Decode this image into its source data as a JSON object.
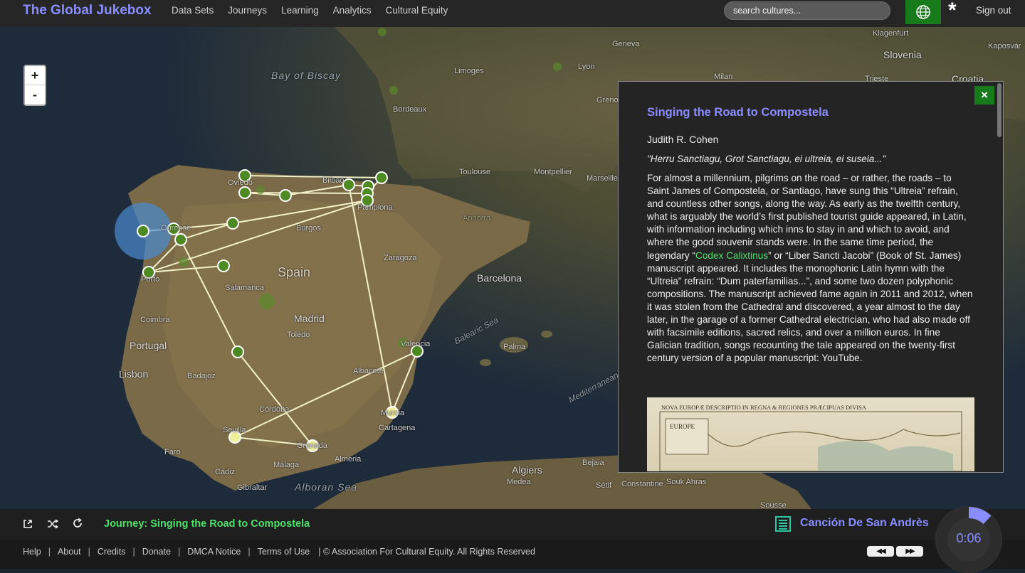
{
  "app": {
    "title": "The Global Jukebox",
    "nav": [
      "Data Sets",
      "Journeys",
      "Learning",
      "Analytics",
      "Cultural Equity"
    ],
    "search_placeholder": "search cultures...",
    "sign_out": "Sign out"
  },
  "map": {
    "zoom_in": "+",
    "zoom_out": "-",
    "labels": {
      "spain": "Spain",
      "portugal": "Portugal",
      "madrid": "Madrid",
      "barcelona": "Barcelona",
      "lisbon": "Lisbon",
      "porto": "Porto",
      "coimbra": "Coimbra",
      "salamanca": "Salamanca",
      "burgos": "Burgos",
      "toledo": "Toledo",
      "zaragoza": "Zaragoza",
      "valencia": "Valencia",
      "albacete": "Albacete",
      "cordoba": "Córdoba",
      "sevilla": "Sevilla",
      "granada": "Granada",
      "malaga": "Málaga",
      "almeria": "Almeria",
      "murcia": "Murcia",
      "cartagena": "Cartagena",
      "cadiz": "Cádiz",
      "faro": "Faro",
      "gibraltar": "Gibraltar",
      "badajoz": "Badajoz",
      "palma": "Palma",
      "oviedo": "Oviedo",
      "bilbao": "Bilbao",
      "pamplona": "Pamplona",
      "toulouse": "Toulouse",
      "montpellier": "Montpellier",
      "marseille": "Marseille",
      "bordeaux": "Bordeaux",
      "limoges": "Limoges",
      "lyon": "Lyon",
      "geneva": "Geneva",
      "milan": "Milan",
      "grenoble": "Grenoble",
      "andorra": "Andorra",
      "ourense": "Ourense",
      "algiers": "Algiers",
      "medea": "Medea",
      "bejaia": "Bejaia",
      "setif": "Sétif",
      "constantine": "Constantine",
      "souk_ahras": "Souk Ahras",
      "sousse": "Sousse",
      "klagenfurt": "Klagenfurt",
      "slovenia": "Slovenia",
      "trieste": "Trieste",
      "kaposvar": "Kaposvár",
      "croatia": "Croatia",
      "bay_of_biscay": "Bay of Biscay",
      "balearic_sea": "Balearic Sea",
      "alboran_sea": "Alboran Sea",
      "mediterranean": "Mediterranean"
    }
  },
  "panel": {
    "close": "×",
    "title": "Singing the Road to Compostela",
    "author": "Judith R. Cohen",
    "quote": "\"Herru Sanctiagu, Grot Sanctiagu, ei ultreia, ei suseia...\"",
    "body_1": "For almost a millennium, pilgrims on the road – or rather, the roads – to Saint James of Compostela, or Santiago, have sung this “Ultreia” refrain, and countless other songs, along the way. As early as the twelfth century, what is arguably the world’s first published tourist guide appeared, in Latin, with information including which inns to stay in and which to avoid, and where the good souvenir stands were. In the same time period, the legendary “",
    "link": "Codex Calixtinus",
    "body_2": "” or “Liber Sancti Jacobi” (Book of St. James) manuscript appeared. It includes the monophonic Latin hymn with the “Ultreia” refrain: “Dum paterfamilias...”, and some two dozen polyphonic compositions. The manuscript achieved fame again in 2011 and 2012, when it was stolen from the Cathedral and discovered, a year almost to the day later, in the garage of a former Cathedral electrician, who had also made off with facsimile editions, sacred relics, and over a million euros. In fine Galician tradition, songs recounting the tale appeared on the twenty-first century version of a popular manuscript: YouTube.",
    "image_caption": "NOVA EUROPÆ DESCRIPTIO IN REGNA & REGIONES PRÆCIPUAS DIVISA"
  },
  "player": {
    "journey": "Journey: Singing the Road to Compostela",
    "song": "Canción De San Andrès",
    "time": "0:06",
    "progress": 0.12
  },
  "footer": {
    "links": [
      "Help",
      "About",
      "Credits",
      "Donate",
      "DMCA Notice",
      "Terms of Use"
    ],
    "copyright": "| © Association For Cultural Equity. All Rights Reserved",
    "rewind": "◀◀",
    "forward": "▶▶"
  }
}
